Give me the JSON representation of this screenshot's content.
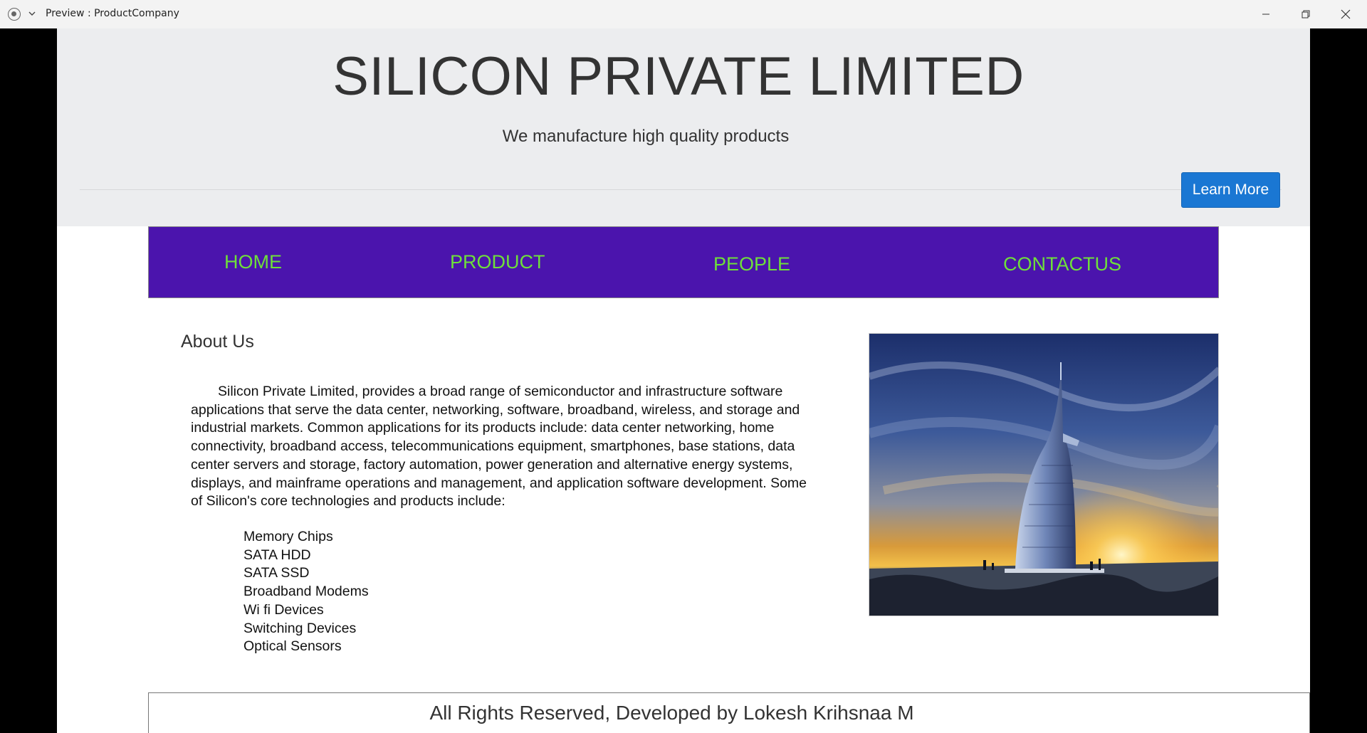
{
  "window": {
    "title": "Preview : ProductCompany"
  },
  "header": {
    "title": "SILICON PRIVATE LIMITED",
    "tagline": "We manufacture high quality products",
    "learn_more_label": "Learn More"
  },
  "nav": {
    "items": [
      {
        "label": "HOME"
      },
      {
        "label": "PRODUCT"
      },
      {
        "label": "PEOPLE"
      },
      {
        "label": "CONTACTUS"
      }
    ]
  },
  "about": {
    "heading": "About Us",
    "paragraph": "Silicon Private Limited, provides a broad range of semiconductor and infrastructure software applications that serve the data center, networking, software, broadband, wireless, and storage and industrial markets. Common applications for its products include: data center networking, home connectivity, broadband access, telecommunications equipment, smartphones, base stations, data center servers and storage, factory automation, power generation and alternative energy systems, displays, and mainframe operations and management, and application software development. Some of Silicon's core technologies and products include:",
    "products": [
      "Memory Chips",
      "SATA HDD",
      "SATA SSD",
      "Broadband Modems",
      "Wi fi Devices",
      "Switching Devices",
      "Optical Sensors"
    ]
  },
  "footer": {
    "text": "All Rights Reserved, Developed by Lokesh Krihsnaa M"
  },
  "colors": {
    "nav_background": "#4b14ad",
    "nav_link": "#6ee03a",
    "button": "#1a77d3",
    "jumbotron": "#ecedef"
  },
  "icons": {
    "app": "record-icon",
    "menu": "chevron-down-icon",
    "minimize": "minimize-icon",
    "maximize": "restore-icon",
    "close": "close-icon"
  }
}
